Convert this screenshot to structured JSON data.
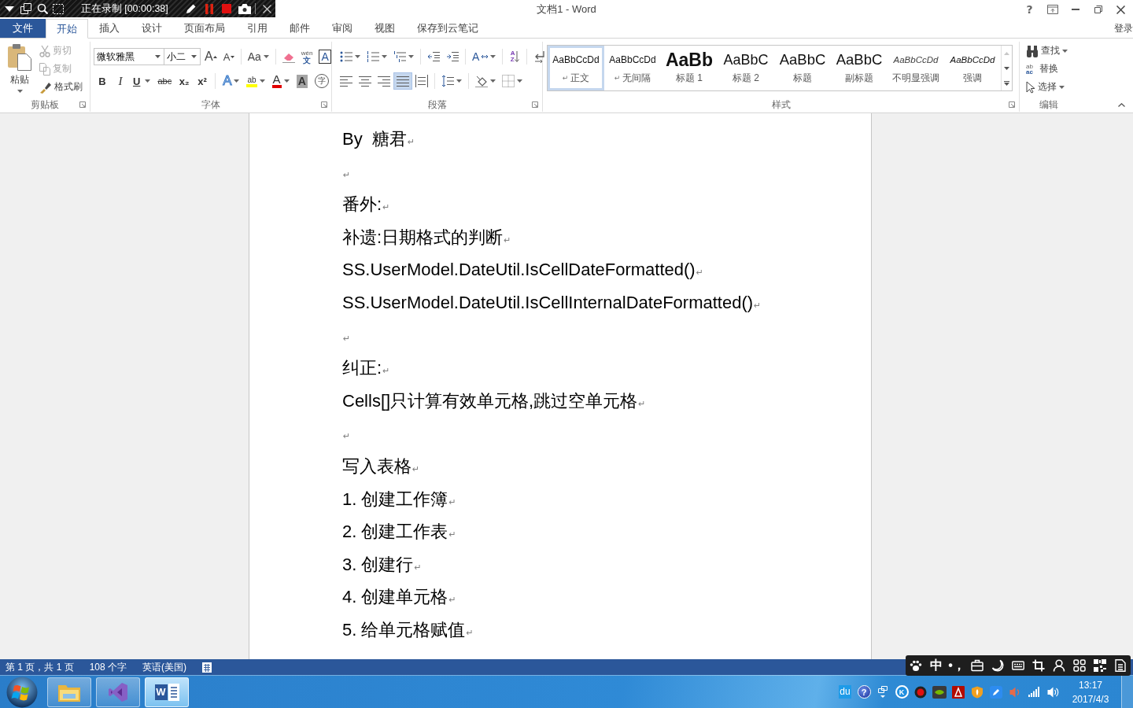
{
  "recorder": {
    "status": "正在录制 [00:00:38]"
  },
  "window": {
    "title": "文档1 - Word",
    "help": "?"
  },
  "tabs": [
    {
      "label": "文件",
      "kind": "file",
      "selected": false
    },
    {
      "label": "开始",
      "kind": "tab",
      "selected": true
    },
    {
      "label": "插入",
      "kind": "tab",
      "selected": false
    },
    {
      "label": "设计",
      "kind": "tab",
      "selected": false
    },
    {
      "label": "页面布局",
      "kind": "tab",
      "selected": false
    },
    {
      "label": "引用",
      "kind": "tab",
      "selected": false
    },
    {
      "label": "邮件",
      "kind": "tab",
      "selected": false
    },
    {
      "label": "审阅",
      "kind": "tab",
      "selected": false
    },
    {
      "label": "视图",
      "kind": "tab",
      "selected": false
    },
    {
      "label": "保存到云笔记",
      "kind": "tab",
      "selected": false
    }
  ],
  "account": {
    "label": "登录"
  },
  "clipboard": {
    "label": "剪贴板",
    "paste": "粘贴",
    "actions": [
      {
        "kind": "cut",
        "label": "剪切",
        "disabled": true
      },
      {
        "kind": "copy",
        "label": "复制",
        "disabled": true
      },
      {
        "kind": "format_painter",
        "label": "格式刷",
        "disabled": false
      }
    ]
  },
  "font": {
    "label": "字体",
    "name": "微软雅黑",
    "size": "小二",
    "row_1": [
      [
        {
          "kind": "grow",
          "glyph": "A",
          "menu": false
        },
        {
          "kind": "shrink",
          "glyph": "A",
          "menu": false
        }
      ],
      [
        {
          "kind": "case",
          "glyph": "Aa",
          "menu": true
        }
      ],
      [
        {
          "kind": "clear",
          "menu": false
        },
        {
          "kind": "pinyin",
          "glyph": "wén",
          "sub": "文",
          "menu": false
        },
        {
          "kind": "border",
          "glyph": "A",
          "menu": false
        }
      ]
    ],
    "row_2": [
      [
        {
          "kind": "bold",
          "glyph": "B",
          "menu": false
        },
        {
          "kind": "italic",
          "glyph": "I",
          "menu": false
        },
        {
          "kind": "underline",
          "glyph": "U",
          "menu": true
        },
        {
          "kind": "strike",
          "glyph": "abc",
          "menu": false
        },
        {
          "kind": "subscript",
          "glyph": "x₂",
          "menu": false
        },
        {
          "kind": "superscript",
          "glyph": "x²",
          "menu": false
        }
      ],
      [
        {
          "kind": "effects",
          "glyph": "A",
          "menu": true
        },
        {
          "kind": "highlight",
          "glyph": "ab",
          "menu": true
        },
        {
          "kind": "color",
          "glyph": "A",
          "menu": true
        },
        {
          "kind": "shading",
          "glyph": "A",
          "menu": false
        },
        {
          "kind": "enclose",
          "glyph": "字",
          "menu": false
        }
      ]
    ]
  },
  "paragraph": {
    "label": "段落",
    "row_1": [
      [
        {
          "kind": "bullets",
          "menu": true
        },
        {
          "kind": "numbering",
          "menu": true
        },
        {
          "kind": "multilevel",
          "menu": true
        }
      ],
      [
        {
          "kind": "outdent",
          "menu": false
        },
        {
          "kind": "indent",
          "menu": false
        }
      ],
      [
        {
          "kind": "asian_layout",
          "glyph": "A",
          "menu": true
        }
      ],
      [
        {
          "kind": "sort",
          "glyph": "AZ",
          "menu": false
        }
      ],
      [
        {
          "kind": "marks",
          "menu": false
        }
      ]
    ],
    "row_2": [
      [
        {
          "kind": "align_left",
          "selected": false,
          "menu": false
        },
        {
          "kind": "align_center",
          "selected": false,
          "menu": false
        },
        {
          "kind": "align_right",
          "selected": false,
          "menu": false
        },
        {
          "kind": "justify",
          "selected": true,
          "menu": false
        },
        {
          "kind": "distribute",
          "selected": false,
          "menu": false
        }
      ],
      [
        {
          "kind": "line_spacing",
          "menu": true
        }
      ],
      [
        {
          "kind": "shading",
          "menu": true
        },
        {
          "kind": "borders",
          "menu": true
        }
      ]
    ]
  },
  "styles": {
    "label": "样式",
    "items": [
      {
        "kind": "normal",
        "preview": "AaBbCcDd",
        "mark": "↵",
        "name": "正文",
        "selected": true
      },
      {
        "kind": "normal",
        "preview": "AaBbCcDd",
        "mark": "↵",
        "name": "无间隔",
        "selected": false
      },
      {
        "kind": "heading1",
        "preview": "AaBb",
        "name": "标题 1",
        "selected": false
      },
      {
        "kind": "heading2",
        "preview": "AaBbC",
        "name": "标题 2",
        "selected": false
      },
      {
        "kind": "title",
        "preview": "AaBbC",
        "name": "标题",
        "selected": false
      },
      {
        "kind": "subtitle",
        "preview": "AaBbC",
        "name": "副标题",
        "selected": false
      },
      {
        "kind": "subtle",
        "preview": "AaBbCcDd",
        "name": "不明显强调",
        "selected": false
      },
      {
        "kind": "emphasis",
        "preview": "AaBbCcDd",
        "name": "强调",
        "selected": false
      }
    ],
    "scroll": [
      {
        "kind": "up",
        "disabled": true
      },
      {
        "kind": "down",
        "disabled": false
      },
      {
        "kind": "more",
        "disabled": false
      }
    ]
  },
  "editing": {
    "label": "编辑",
    "items": [
      {
        "kind": "find",
        "label": "查找",
        "menu": true
      },
      {
        "kind": "replace",
        "glyph": [
          "ab",
          "ac"
        ],
        "label": "替换",
        "menu": false
      },
      {
        "kind": "select",
        "label": "选择",
        "menu": true
      }
    ]
  },
  "document": {
    "paragraphs": [
      {
        "text": "By  糖君",
        "mark": "↵"
      },
      {
        "mark": "↵"
      },
      {
        "text": "番外:",
        "mark": "↵"
      },
      {
        "text": "补遗:日期格式的判断",
        "mark": "↵"
      },
      {
        "text": "SS.UserModel.DateUtil.IsCellDateFormatted()",
        "mark": "↵"
      },
      {
        "text": "SS.UserModel.DateUtil.IsCellInternalDateFormatted()",
        "mark": "↵"
      },
      {
        "mark": "↵"
      },
      {
        "text": "纠正:",
        "mark": "↵"
      },
      {
        "text": "Cells[]只计算有效单元格,跳过空单元格",
        "mark": "↵"
      },
      {
        "mark": "↵"
      },
      {
        "text": "写入表格",
        "mark": "↵"
      },
      {
        "text": "1. 创建工作簿",
        "mark": "↵"
      },
      {
        "text": "2. 创建工作表",
        "mark": "↵"
      },
      {
        "text": "3. 创建行",
        "mark": "↵"
      },
      {
        "text": "4. 创建单元格",
        "mark": "↵"
      },
      {
        "text": "5. 给单元格赋值",
        "mark": "↵"
      }
    ]
  },
  "status_bar": {
    "items": [
      "第 1 页，共 1 页",
      "108 个字",
      "英语(美国)"
    ]
  },
  "ime_bar": {
    "items": [
      {
        "kind": "paw"
      },
      {
        "kind": "text",
        "text": "中"
      },
      {
        "kind": "text",
        "text": "•，"
      },
      {
        "kind": "briefcase"
      },
      {
        "kind": "moon"
      },
      {
        "kind": "keyboard"
      },
      {
        "kind": "crop"
      },
      {
        "kind": "person"
      },
      {
        "kind": "grid"
      },
      {
        "kind": "qr"
      },
      {
        "kind": "document"
      }
    ]
  },
  "taskbar": {
    "apps": [
      {
        "kind": "explorer",
        "selected": false
      },
      {
        "kind": "studio",
        "selected": false
      },
      {
        "kind": "word",
        "glyph": "W",
        "selected": true
      }
    ],
    "tray": [
      {
        "kind": "tile",
        "text": "du"
      },
      {
        "kind": "help",
        "text": "?"
      },
      {
        "kind": "windows"
      },
      {
        "kind": "circle",
        "text": "K"
      },
      {
        "kind": "record"
      },
      {
        "kind": "eye"
      },
      {
        "kind": "red_tile"
      },
      {
        "kind": "shield"
      },
      {
        "kind": "blue_tile"
      },
      {
        "kind": "speaker"
      },
      {
        "kind": "signal"
      },
      {
        "kind": "volume"
      }
    ],
    "time": "13:17",
    "date": "2017/4/3"
  }
}
